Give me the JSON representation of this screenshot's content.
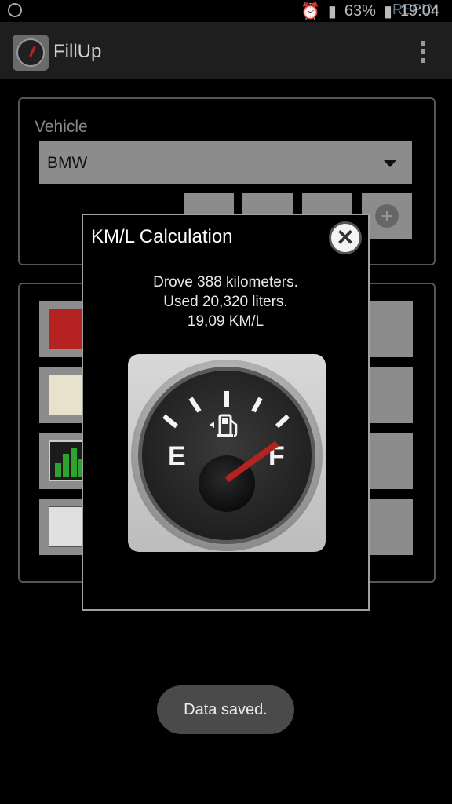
{
  "status_bar": {
    "reply": "REPLY",
    "battery": "63%",
    "time": "19:04"
  },
  "app_bar": {
    "title": "FillUp"
  },
  "vehicle_panel": {
    "label": "Vehicle",
    "selected": "BMW"
  },
  "dialog": {
    "title": "KM/L Calculation",
    "line1": "Drove 388 kilometers.",
    "line2": "Used 20,320 liters.",
    "line3": "19,09 KM/L",
    "gauge": {
      "left_label": "E",
      "right_label": "F"
    }
  },
  "toast": {
    "text": "Data saved."
  },
  "colors": {
    "needle": "#b3231f",
    "dialog_border": "#a0a0a0",
    "toast_bg": "#4a4a4a"
  }
}
